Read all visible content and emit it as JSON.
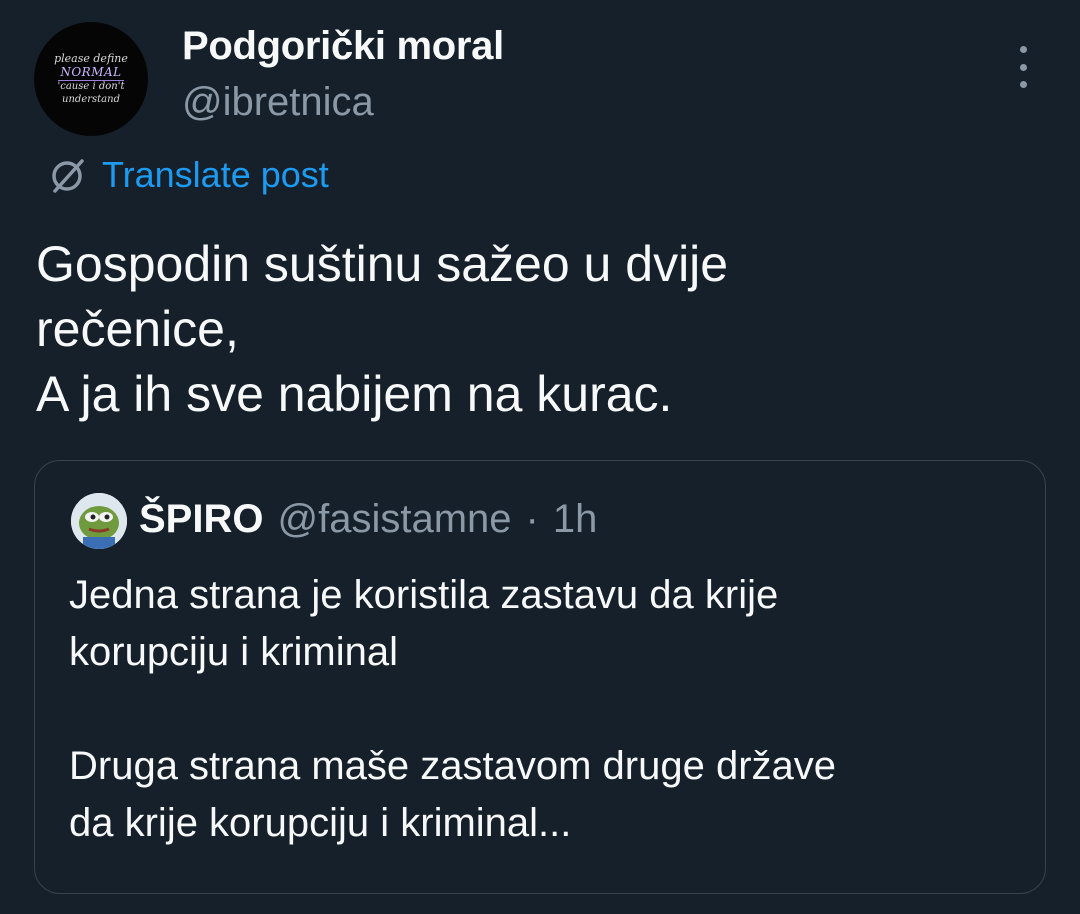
{
  "post": {
    "avatar_text": [
      "please define",
      "NORMAL",
      "'cause i don't",
      "understand"
    ],
    "display_name": "Podgorički moral",
    "handle": "@ibretnica",
    "translate_label": "Translate post",
    "text": "Gospodin suštinu sažeo u dvije\nrečenice,\nA ja ih sve nabijem na kurac."
  },
  "quote": {
    "display_name": "ŠPIRO",
    "handle": "@fasistamne",
    "separator": "·",
    "time": "1h",
    "text": "Jedna strana je koristila zastavu da krije\nkorupciju i kriminal\n\nDruga strana maše zastavom druge države\nda krije korupciju i kriminal..."
  },
  "icons": {
    "more": "more-vertical-icon",
    "translate": "translate-globe-icon",
    "quote_avatar": "pepe-frog-avatar"
  },
  "colors": {
    "background": "#15202b",
    "text": "#f7f9f9",
    "secondary_text": "#8b98a5",
    "link": "#1d9bf0",
    "border": "#38444d"
  }
}
